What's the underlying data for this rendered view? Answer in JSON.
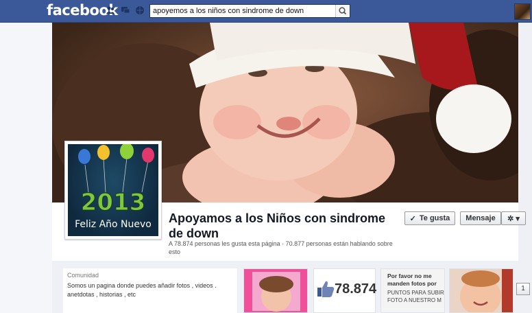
{
  "topbar": {
    "logo": "facebook",
    "search_value": "apoyemos a los niños con sindrome de down"
  },
  "page": {
    "name": "Apoyamos a los Niños con sindrome de down",
    "stats": "A 78.874 personas les gusta esta página · 70.877 personas están hablando sobre esto",
    "profile_caption": "Feliz Año Nuevo",
    "profile_year": "2013"
  },
  "actions": {
    "like_label": "Te gusta",
    "like_check": "✓",
    "message_label": "Mensaje",
    "settings_glyph": "✲",
    "settings_caret": "▾"
  },
  "about": {
    "heading": "Comunidad",
    "text": "Somos un pagina donde puedes añadir fotos , videos . anetdotas , historias , etc"
  },
  "apps": {
    "likes_count": "78.874",
    "promo_title": "Por favor no me manden fotos por",
    "promo_body": "PUNTOS PARA SUBIR FOTO A NUESTRO M",
    "scroll_label": "1"
  },
  "colors": {
    "brand": "#3b5998",
    "text": "#141823"
  }
}
